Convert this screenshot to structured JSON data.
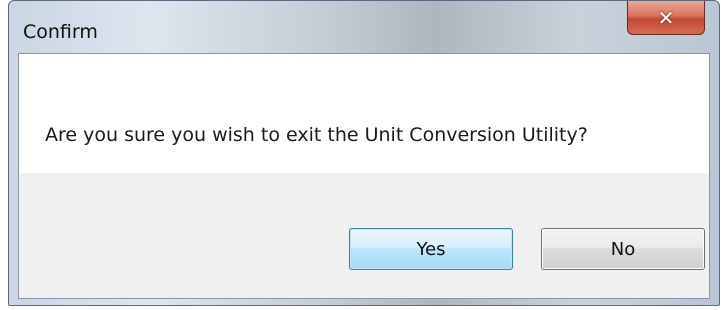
{
  "window": {
    "title": "Confirm",
    "close_icon": "close-icon"
  },
  "message": {
    "text": "Are you sure you wish to exit the Unit Conversion Utility?"
  },
  "buttons": {
    "yes_label": "Yes",
    "no_label": "No"
  },
  "colors": {
    "close_button": "#c44a32",
    "default_button_border": "#3c7fb1"
  }
}
